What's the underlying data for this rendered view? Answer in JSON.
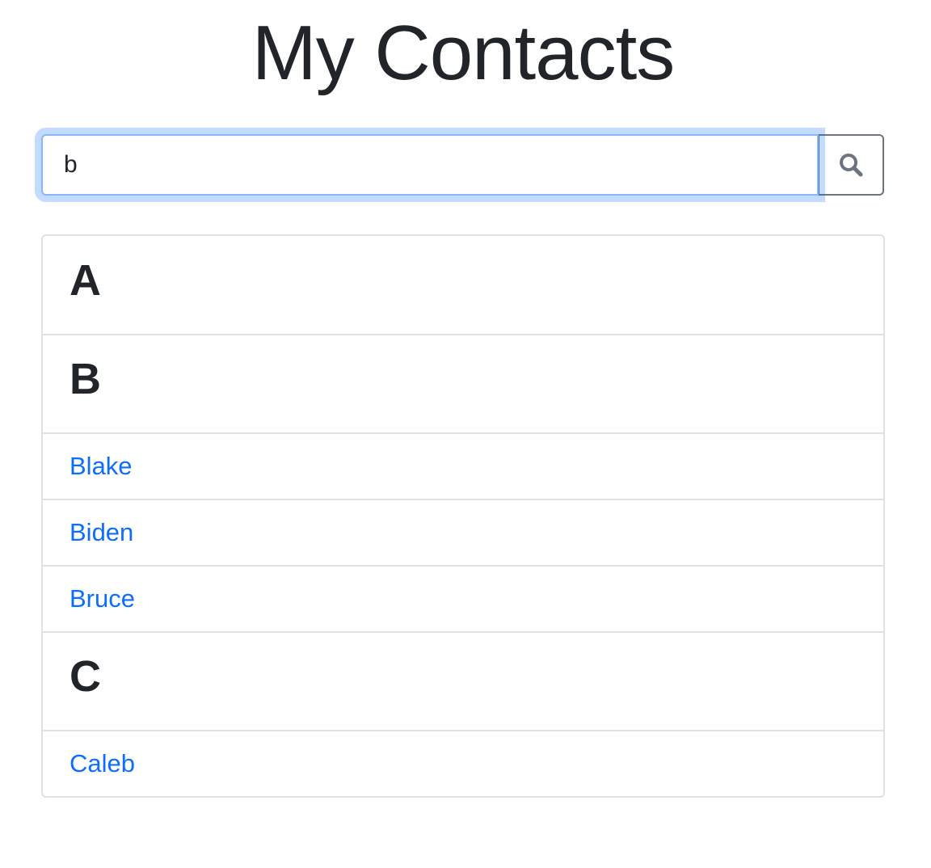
{
  "page": {
    "title": "My Contacts"
  },
  "search": {
    "value": "b",
    "icon": "search-icon"
  },
  "contacts": {
    "sections": [
      {
        "letter": "A",
        "names": []
      },
      {
        "letter": "B",
        "names": [
          "Blake",
          "Biden",
          "Bruce"
        ]
      },
      {
        "letter": "C",
        "names": [
          "Caleb"
        ]
      }
    ]
  },
  "colors": {
    "text": "#212529",
    "link": "#0d6efd",
    "focus_border": "#86b7fe",
    "button_border": "#6c757d",
    "list_border": "#dee2e6"
  }
}
